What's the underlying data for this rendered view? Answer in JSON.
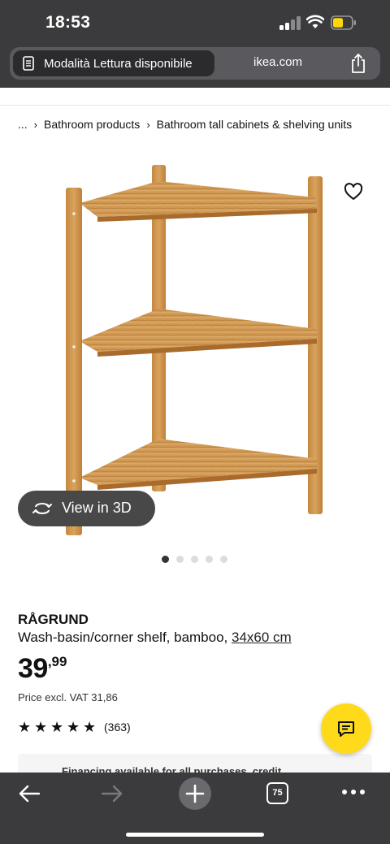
{
  "status_bar": {
    "time": "18:53"
  },
  "browser": {
    "reader_mode_label": "Modalità Lettura disponibile",
    "domain": "ikea.com",
    "tab_count": "75"
  },
  "breadcrumb": {
    "ellipsis": "...",
    "items": [
      "Bathroom products",
      "Bathroom tall cabinets & shelving units"
    ]
  },
  "gallery": {
    "view_3d_label": "View in 3D",
    "image_count": 5,
    "active_index": 0
  },
  "product": {
    "name": "RÅGRUND",
    "description": "Wash-basin/corner shelf, bamboo, ",
    "dimensions": "34x60 cm",
    "price_integer": "39",
    "price_decimal": ",99",
    "price_excl_vat": "Price excl. VAT 31,86",
    "rating": 5,
    "reviews": "(363)"
  },
  "financing": {
    "text": "Financing available for all purchases, credit"
  },
  "colors": {
    "chrome": "#3b3b3d",
    "accent_yellow": "#ffda1a",
    "wood": "#c98f4a"
  }
}
